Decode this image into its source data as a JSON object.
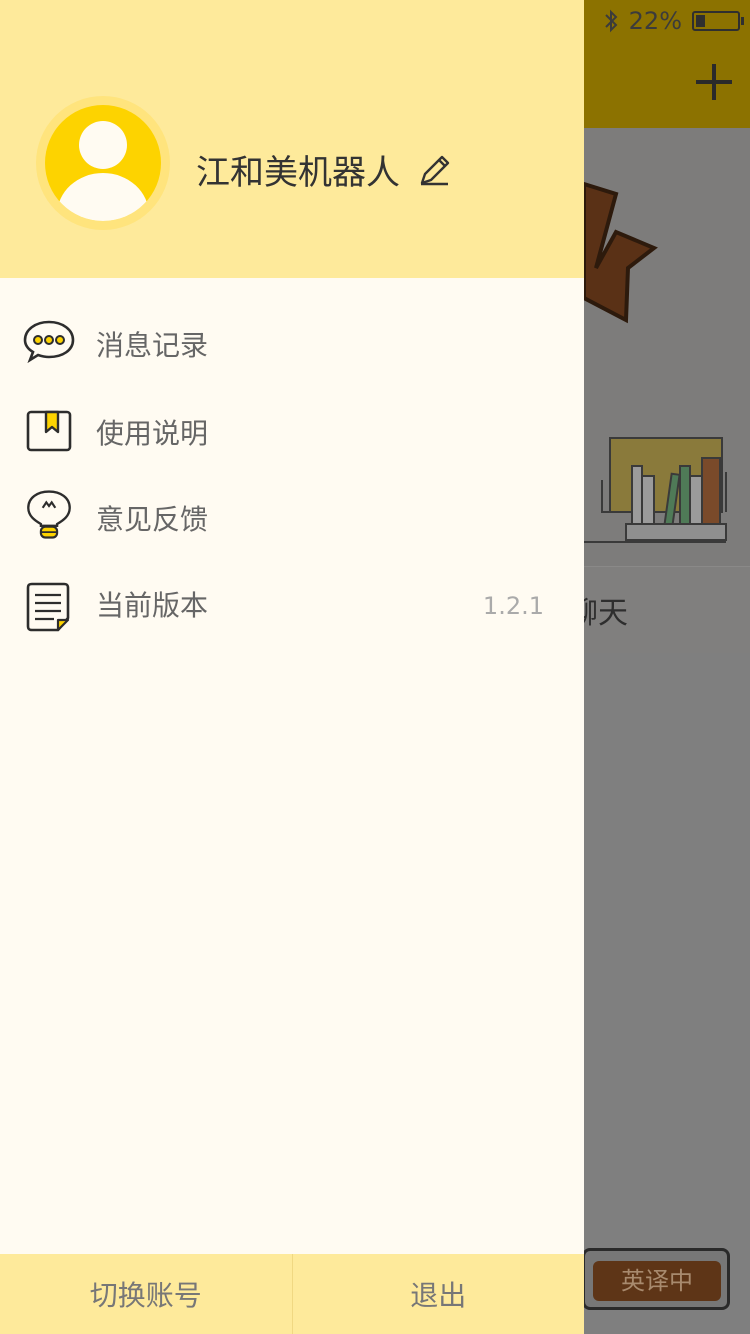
{
  "status_bar": {
    "battery_percent": "22%",
    "battery_level": 0.22,
    "bluetooth_icon": "bluetooth-icon"
  },
  "background": {
    "row_label": "聊天",
    "translate_button": "英译中",
    "add_icon": "plus-icon"
  },
  "drawer": {
    "user": {
      "name": "江和美机器人",
      "edit_icon": "pencil-icon",
      "avatar_icon": "user-avatar-icon"
    },
    "menu": [
      {
        "label": "消息记录",
        "icon": "chat-bubble-icon"
      },
      {
        "label": "使用说明",
        "icon": "bookmark-book-icon"
      },
      {
        "label": "意见反馈",
        "icon": "lightbulb-icon"
      },
      {
        "label": "当前版本",
        "icon": "document-icon",
        "value": "1.2.1"
      }
    ],
    "bottom": {
      "switch_account": "切换账号",
      "logout": "退出"
    }
  },
  "colors": {
    "drawer_header": "#feea9b",
    "drawer_body": "#fffbf2",
    "accent_yellow": "#fdd300"
  }
}
